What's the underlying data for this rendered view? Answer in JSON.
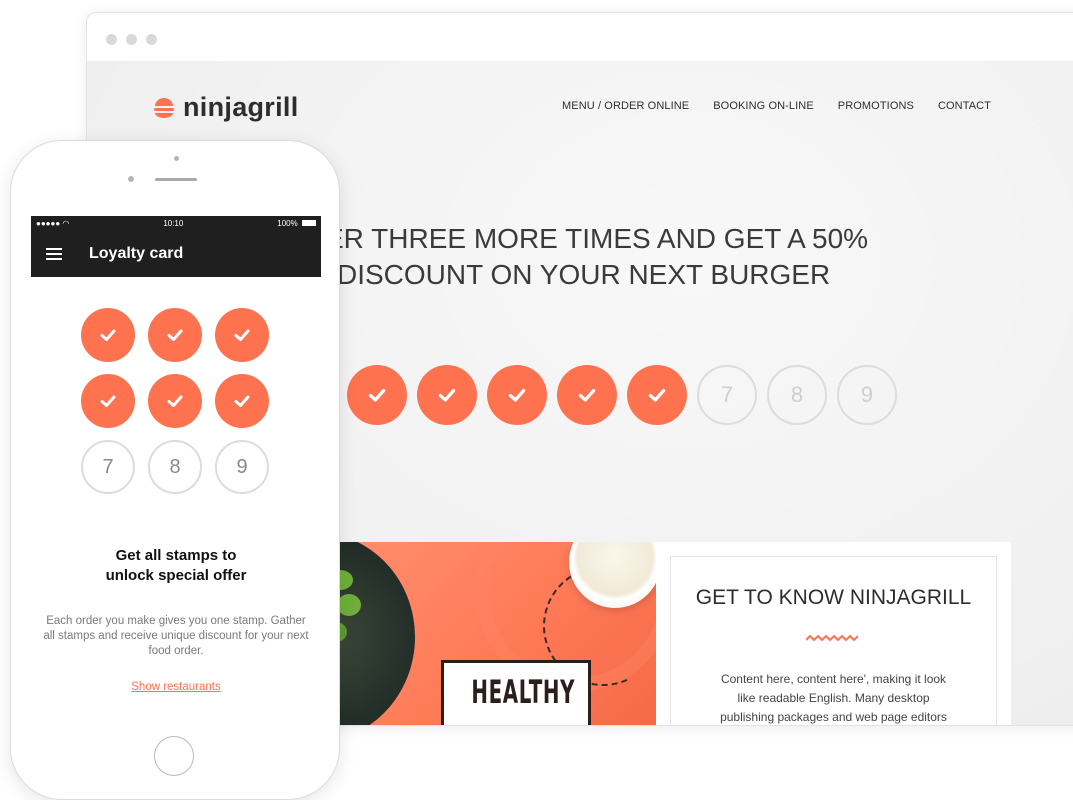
{
  "browser": {
    "logo_text": "ninjagrill",
    "nav": [
      "MENU / ORDER ONLINE",
      "BOOKING ON-LINE",
      "PROMOTIONS",
      "CONTACT"
    ],
    "headline_line1": "ER THREE MORE TIMES AND GET A 50%",
    "headline_line2": "DISCOUNT ON YOUR NEXT BURGER",
    "stamps": [
      {
        "filled": true,
        "label": ""
      },
      {
        "filled": true,
        "label": ""
      },
      {
        "filled": true,
        "label": ""
      },
      {
        "filled": true,
        "label": ""
      },
      {
        "filled": true,
        "label": ""
      },
      {
        "filled": false,
        "label": "7"
      },
      {
        "filled": false,
        "label": "8"
      },
      {
        "filled": false,
        "label": "9"
      }
    ],
    "food_card_text": "HEALTHY",
    "about_title": "GET TO KNOW NINJAGRILL",
    "about_text": "Content here, content here', making it look like readable English. Many desktop publishing packages and web page editors"
  },
  "phone": {
    "status_time": "10:10",
    "status_battery": "100%",
    "app_title": "Loyalty card",
    "stamps": [
      {
        "filled": true,
        "label": ""
      },
      {
        "filled": true,
        "label": ""
      },
      {
        "filled": true,
        "label": ""
      },
      {
        "filled": true,
        "label": ""
      },
      {
        "filled": true,
        "label": ""
      },
      {
        "filled": true,
        "label": ""
      },
      {
        "filled": false,
        "label": "7"
      },
      {
        "filled": false,
        "label": "8"
      },
      {
        "filled": false,
        "label": "9"
      }
    ],
    "offer_title": "Get all stamps to unlock special offer",
    "description": "Each order you make gives you one stamp. Gather all stamps and receive unique discount for your next food order.",
    "link_label": "Show restaurants"
  },
  "colors": {
    "accent": "#ff7250",
    "dark_bar": "#1f1f1f",
    "stamp_empty_border": "#dcdcdc"
  }
}
